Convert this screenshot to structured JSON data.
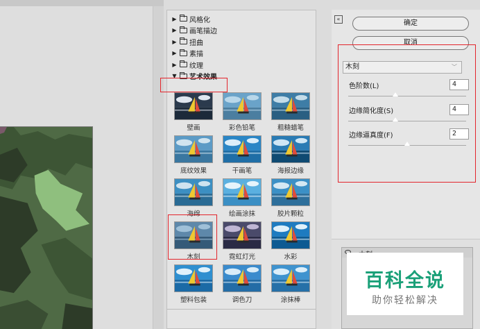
{
  "filter_tree": [
    {
      "label": "风格化",
      "expanded": false
    },
    {
      "label": "画笔描边",
      "expanded": false
    },
    {
      "label": "扭曲",
      "expanded": false
    },
    {
      "label": "素描",
      "expanded": false
    },
    {
      "label": "纹理",
      "expanded": false
    },
    {
      "label": "艺术效果",
      "expanded": true
    }
  ],
  "thumbnails": [
    {
      "label": "壁画",
      "style": "mural"
    },
    {
      "label": "彩色铅笔",
      "style": "pencil"
    },
    {
      "label": "粗糙蜡笔",
      "style": "crayon"
    },
    {
      "label": "底纹效果",
      "style": "texture"
    },
    {
      "label": "干画笔",
      "style": "dry"
    },
    {
      "label": "海报边缘",
      "style": "poster"
    },
    {
      "label": "海绵",
      "style": "sponge"
    },
    {
      "label": "绘画涂抹",
      "style": "smudge"
    },
    {
      "label": "胶片颗粒",
      "style": "grain"
    },
    {
      "label": "木刻",
      "style": "cutout"
    },
    {
      "label": "霓虹灯光",
      "style": "neon"
    },
    {
      "label": "水彩",
      "style": "watercolor"
    },
    {
      "label": "塑料包装",
      "style": "plastic"
    },
    {
      "label": "调色刀",
      "style": "knife"
    },
    {
      "label": "涂抹棒",
      "style": "stick"
    }
  ],
  "settings": {
    "collapse_glyph": "«",
    "ok_label": "确定",
    "cancel_label": "取消",
    "filter_selected": "木刻",
    "params": [
      {
        "label": "色阶数(L)",
        "value": "4",
        "slider": 0.4
      },
      {
        "label": "边缘简化度(S)",
        "value": "4",
        "slider": 0.4
      },
      {
        "label": "边缘逼真度(F)",
        "value": "2",
        "slider": 0.5
      }
    ],
    "layer_name": "木刻"
  },
  "watermark": {
    "main": "百科全说",
    "sub": "助你轻松解决"
  },
  "colors": {
    "annotation_red": "#e3242b",
    "watermark_green": "#1aa078",
    "cutout_dark": "#2d3b28",
    "cutout_mid": "#4f6a45",
    "cutout_light": "#8fbf7e"
  }
}
